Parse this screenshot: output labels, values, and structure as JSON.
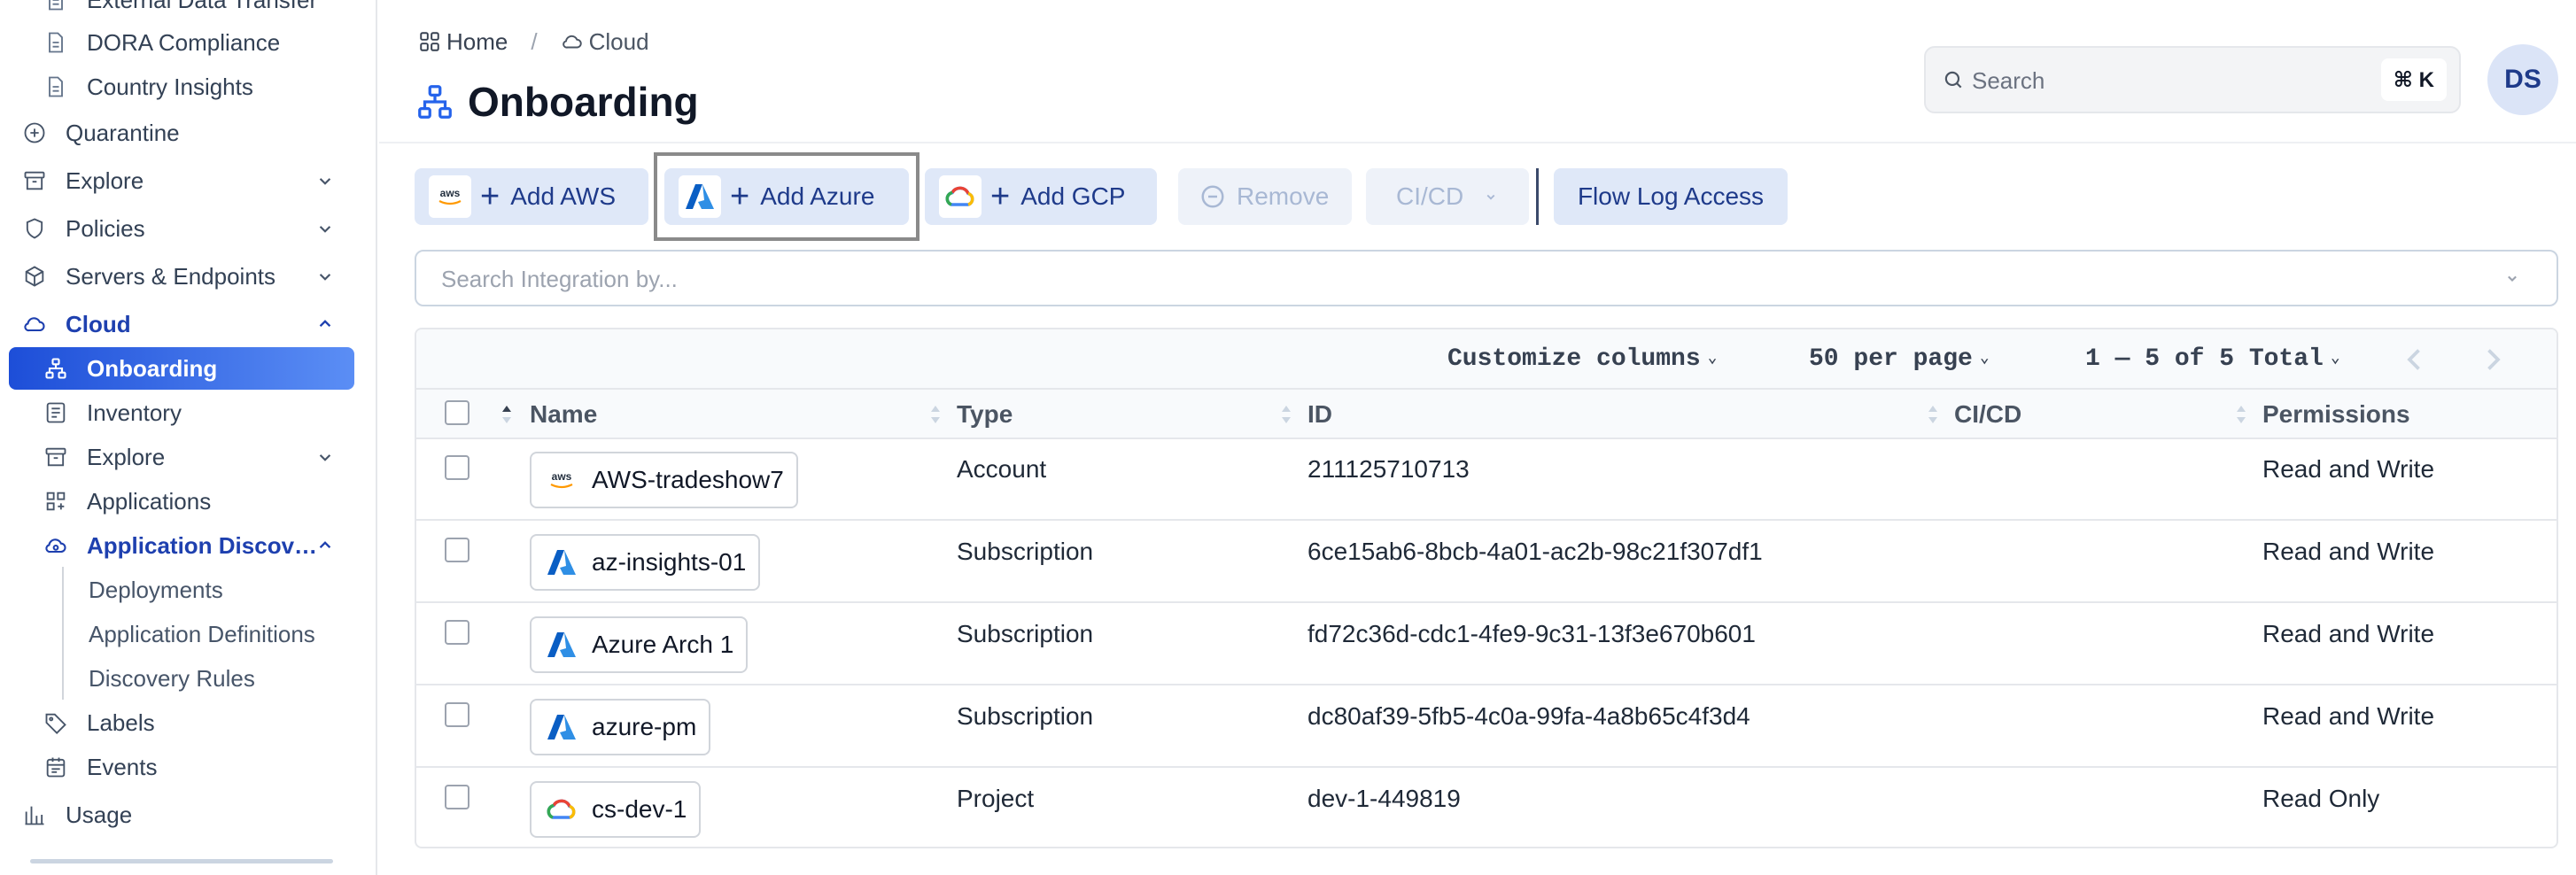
{
  "sidebar": {
    "items": [
      {
        "label": "External Data Transfer",
        "icon": "document-icon"
      },
      {
        "label": "DORA Compliance",
        "icon": "document-icon"
      },
      {
        "label": "Country Insights",
        "icon": "document-icon"
      },
      {
        "label": "Quarantine",
        "icon": "shield-plus-icon"
      },
      {
        "label": "Explore",
        "icon": "archive-icon"
      },
      {
        "label": "Policies",
        "icon": "shield-icon"
      },
      {
        "label": "Servers & Endpoints",
        "icon": "cube-icon"
      },
      {
        "label": "Cloud",
        "icon": "cloud-icon"
      },
      {
        "label": "Onboarding",
        "icon": "hierarchy-icon"
      },
      {
        "label": "Inventory",
        "icon": "list-icon"
      },
      {
        "label": "Explore",
        "icon": "archive-icon"
      },
      {
        "label": "Applications",
        "icon": "grid-plus-icon"
      },
      {
        "label": "Application Discov…",
        "icon": "cloud-eye-icon"
      },
      {
        "label": "Deployments"
      },
      {
        "label": "Application Definitions"
      },
      {
        "label": "Discovery Rules"
      },
      {
        "label": "Labels",
        "icon": "tag-icon"
      },
      {
        "label": "Events",
        "icon": "calendar-icon"
      },
      {
        "label": "Usage",
        "icon": "bar-chart-icon"
      }
    ]
  },
  "header": {
    "breadcrumb": {
      "home": "Home",
      "separator": "/",
      "current": "Cloud"
    },
    "title": "Onboarding",
    "search": {
      "placeholder": "Search",
      "shortcut": "⌘ K"
    },
    "avatar": "DS"
  },
  "toolbar": {
    "add_aws": "Add AWS",
    "add_azure": "Add Azure",
    "add_gcp": "Add GCP",
    "remove": "Remove",
    "cicd": "CI/CD",
    "flow_log": "Flow Log Access",
    "aws_logo_text": "aws"
  },
  "integration_search": {
    "placeholder": "Search Integration by..."
  },
  "table": {
    "pager": {
      "customize": "Customize columns",
      "per_page": "50 per page",
      "range": "1 — 5 of 5 Total"
    },
    "columns": {
      "name": "Name",
      "type": "Type",
      "id": "ID",
      "cicd": "CI/CD",
      "permissions": "Permissions"
    },
    "rows": [
      {
        "name": "AWS-tradeshow7",
        "provider": "aws",
        "type": "Account",
        "id": "211125710713",
        "cicd": "",
        "permissions": "Read and Write"
      },
      {
        "name": "az-insights-01",
        "provider": "azure",
        "type": "Subscription",
        "id": "6ce15ab6-8bcb-4a01-ac2b-98c21f307df1",
        "cicd": "",
        "permissions": "Read and Write"
      },
      {
        "name": "Azure Arch 1",
        "provider": "azure",
        "type": "Subscription",
        "id": "fd72c36d-cdc1-4fe9-9c31-13f3e670b601",
        "cicd": "",
        "permissions": "Read and Write"
      },
      {
        "name": "azure-pm",
        "provider": "azure",
        "type": "Subscription",
        "id": "dc80af39-5fb5-4c0a-99fa-4a8b65c4f3d4",
        "cicd": "",
        "permissions": "Read and Write"
      },
      {
        "name": "cs-dev-1",
        "provider": "gcp",
        "type": "Project",
        "id": "dev-1-449819",
        "cicd": "",
        "permissions": "Read Only"
      }
    ]
  },
  "colors": {
    "accent": "#1e40af",
    "selected_gradient_start": "#1d4ed8",
    "selected_gradient_end": "#5b8ef5",
    "button_bg": "#dfe8f8"
  }
}
